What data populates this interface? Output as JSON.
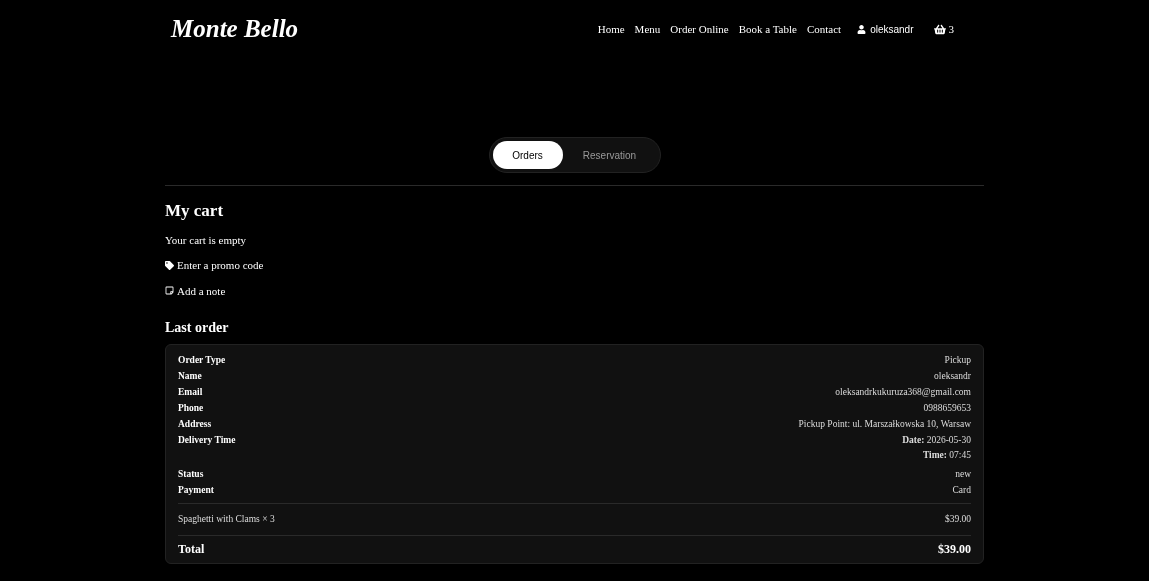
{
  "brand": "Monte Bello",
  "nav": {
    "links": [
      "Home",
      "Menu",
      "Order Online",
      "Book a Table",
      "Contact"
    ],
    "user": "oleksandr",
    "cart_count": "3"
  },
  "tabs": [
    {
      "label": "Orders",
      "selected": true
    },
    {
      "label": "Reservation",
      "selected": false
    }
  ],
  "cart": {
    "title": "My cart",
    "empty_message": "Your cart is empty",
    "promo_link": "Enter a promo code",
    "note_link": "Add a note"
  },
  "last_order": {
    "title": "Last order",
    "fields": [
      {
        "label": "Order Type",
        "value": [
          "Pickup"
        ]
      },
      {
        "label": "Name",
        "value": [
          "oleksandr"
        ]
      },
      {
        "label": "Email",
        "value": [
          "oleksandrkukuruza368@gmail.com"
        ]
      },
      {
        "label": "Phone",
        "value": [
          "0988659653"
        ]
      },
      {
        "label": "Address",
        "value": [
          "Pickup Point: ul. Marszałkowska 10, Warsaw"
        ]
      },
      {
        "label": "Delivery Time",
        "value": [
          "**Date:** 2026-05-30",
          "**Time:** 07:45"
        ]
      },
      {
        "label": "Status",
        "value": [
          "new"
        ]
      },
      {
        "label": "Payment",
        "value": [
          "Card"
        ]
      }
    ],
    "items": [
      {
        "name": "Spaghetti with Clams × 3",
        "price": "$39.00"
      }
    ],
    "total_label": "Total",
    "total": "$39.00"
  }
}
